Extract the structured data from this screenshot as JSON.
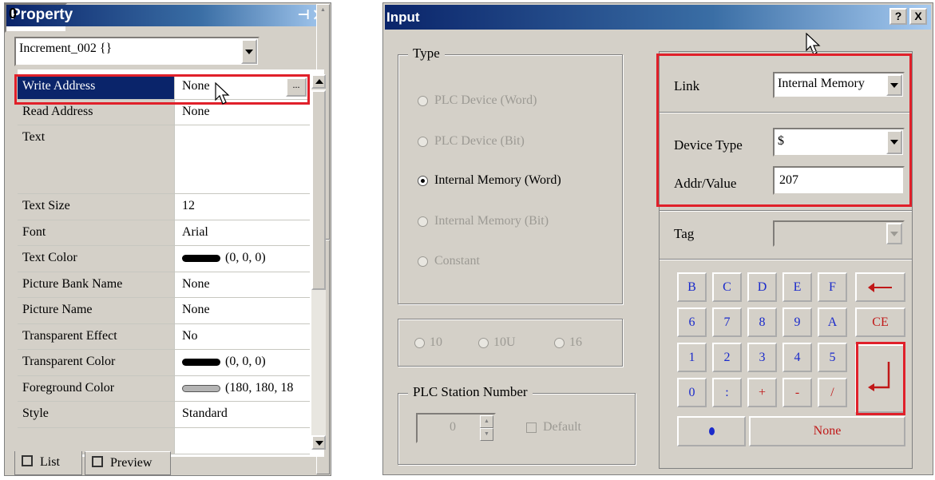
{
  "property_panel": {
    "title": "Property",
    "object_selector": "Increment_002 {}",
    "object_index": "0",
    "rows": [
      {
        "name": "Write Address",
        "value": "None"
      },
      {
        "name": "Read Address",
        "value": "None"
      },
      {
        "name": "Text",
        "value": ""
      },
      {
        "name": "Text Size",
        "value": "12"
      },
      {
        "name": "Font",
        "value": "Arial"
      },
      {
        "name": "Text Color",
        "value": "(0, 0, 0)",
        "swatch": "#000000"
      },
      {
        "name": "Picture Bank Name",
        "value": "None"
      },
      {
        "name": "Picture Name",
        "value": "None"
      },
      {
        "name": "Transparent Effect",
        "value": "No"
      },
      {
        "name": "Transparent Color",
        "value": "(0, 0, 0)",
        "swatch": "#000000"
      },
      {
        "name": "Foreground Color",
        "value": "(180, 180, 18",
        "swatch": "#b4b4b4"
      },
      {
        "name": "Style",
        "value": "Standard"
      }
    ],
    "ellipsis_label": "...",
    "tabs": {
      "list": "List",
      "preview": "Preview"
    }
  },
  "input_dialog": {
    "title": "Input",
    "help_label": "?",
    "close_label": "X",
    "type_group": {
      "legend": "Type",
      "options": [
        "PLC Device (Word)",
        "PLC Device (Bit)",
        "Internal Memory (Word)",
        "Internal Memory (Bit)",
        "Constant"
      ],
      "selected": "Internal Memory (Word)"
    },
    "base": [
      "10",
      "10U",
      "16"
    ],
    "plc_station": {
      "legend": "PLC Station Number",
      "value": "0",
      "default_label": "Default"
    },
    "link": {
      "label": "Link",
      "value": "Internal Memory"
    },
    "device_type": {
      "label": "Device Type",
      "value": "$"
    },
    "addr_value": {
      "label": "Addr/Value",
      "value": "207"
    },
    "tag": {
      "label": "Tag",
      "value": ""
    },
    "keypad": {
      "row1": [
        "B",
        "C",
        "D",
        "E",
        "F"
      ],
      "row2": [
        "6",
        "7",
        "8",
        "9",
        "A"
      ],
      "row3": [
        "1",
        "2",
        "3",
        "4",
        "5"
      ],
      "row4": [
        "0",
        ":",
        "+",
        "-",
        "/"
      ],
      "ce": "CE",
      "none": "None",
      "enter_icon": "enter-arrow-icon",
      "backspace_icon": "left-arrow-icon"
    },
    "colors": {
      "highlight": "#e0202a",
      "key_text": "#1a2acb",
      "key_red": "#c01818"
    }
  }
}
